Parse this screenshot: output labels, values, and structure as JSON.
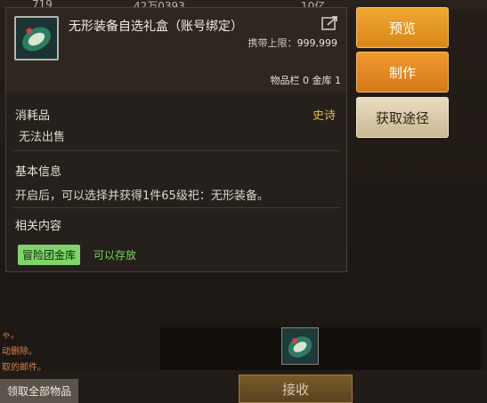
{
  "top_stats": [
    "719",
    "42万0393",
    "10亿"
  ],
  "tooltip": {
    "title": "无形装备自选礼盒（账号绑定）",
    "carry_label": "携带上限：",
    "carry_value": "999,999",
    "stock": "物品栏 0 金库 1",
    "type": "消耗品",
    "rarity": "史诗",
    "trade": "无法出售",
    "basic_info_label": "基本信息",
    "description": "开启后，可以选择并获得1件65级祀：无形装备。",
    "related_label": "相关内容",
    "storage_tag": "冒险团金库",
    "storable": "可以存放"
  },
  "buttons": {
    "preview": "预览",
    "craft": "制作",
    "source": "获取途径"
  },
  "mail": {
    "note1": "ゃ。",
    "note2": "动删除。",
    "note3": "取的邮件。",
    "claim_all": "领取全部物品",
    "receive": "接收"
  },
  "colors": {
    "rarity_epic": "#e0b84a",
    "storable_green": "#73d65c",
    "button_orange": "#e89427",
    "button_beige": "#d8cba8"
  }
}
